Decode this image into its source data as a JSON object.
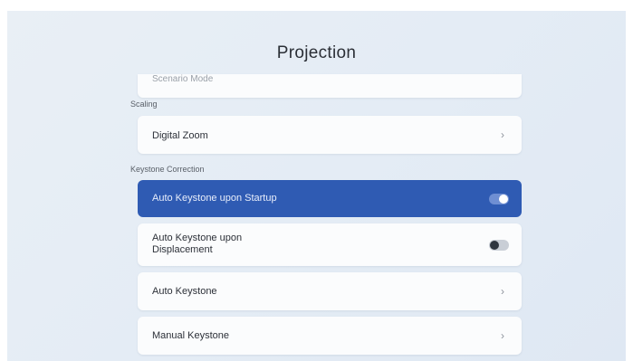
{
  "header": {
    "title": "Projection"
  },
  "partial_item": {
    "label": "Scenario Mode"
  },
  "sections": {
    "scaling": {
      "label": "Scaling",
      "items": [
        {
          "label": "Digital Zoom",
          "icon": "chevron-right-icon"
        }
      ]
    },
    "keystone": {
      "label": "Keystone Correction",
      "items": [
        {
          "label": "Auto Keystone upon Startup",
          "type": "toggle",
          "state": "on",
          "selected": true
        },
        {
          "label": "Auto Keystone upon\nDisplacement",
          "type": "toggle",
          "state": "off"
        },
        {
          "label": "Auto Keystone",
          "icon": "chevron-right-icon"
        },
        {
          "label": "Manual Keystone",
          "icon": "chevron-right-icon"
        }
      ]
    }
  },
  "glyphs": {
    "chevron": "›"
  },
  "colors": {
    "accent": "#2f5bb3",
    "background": "#e6edf5",
    "card": "#fbfcfd"
  }
}
